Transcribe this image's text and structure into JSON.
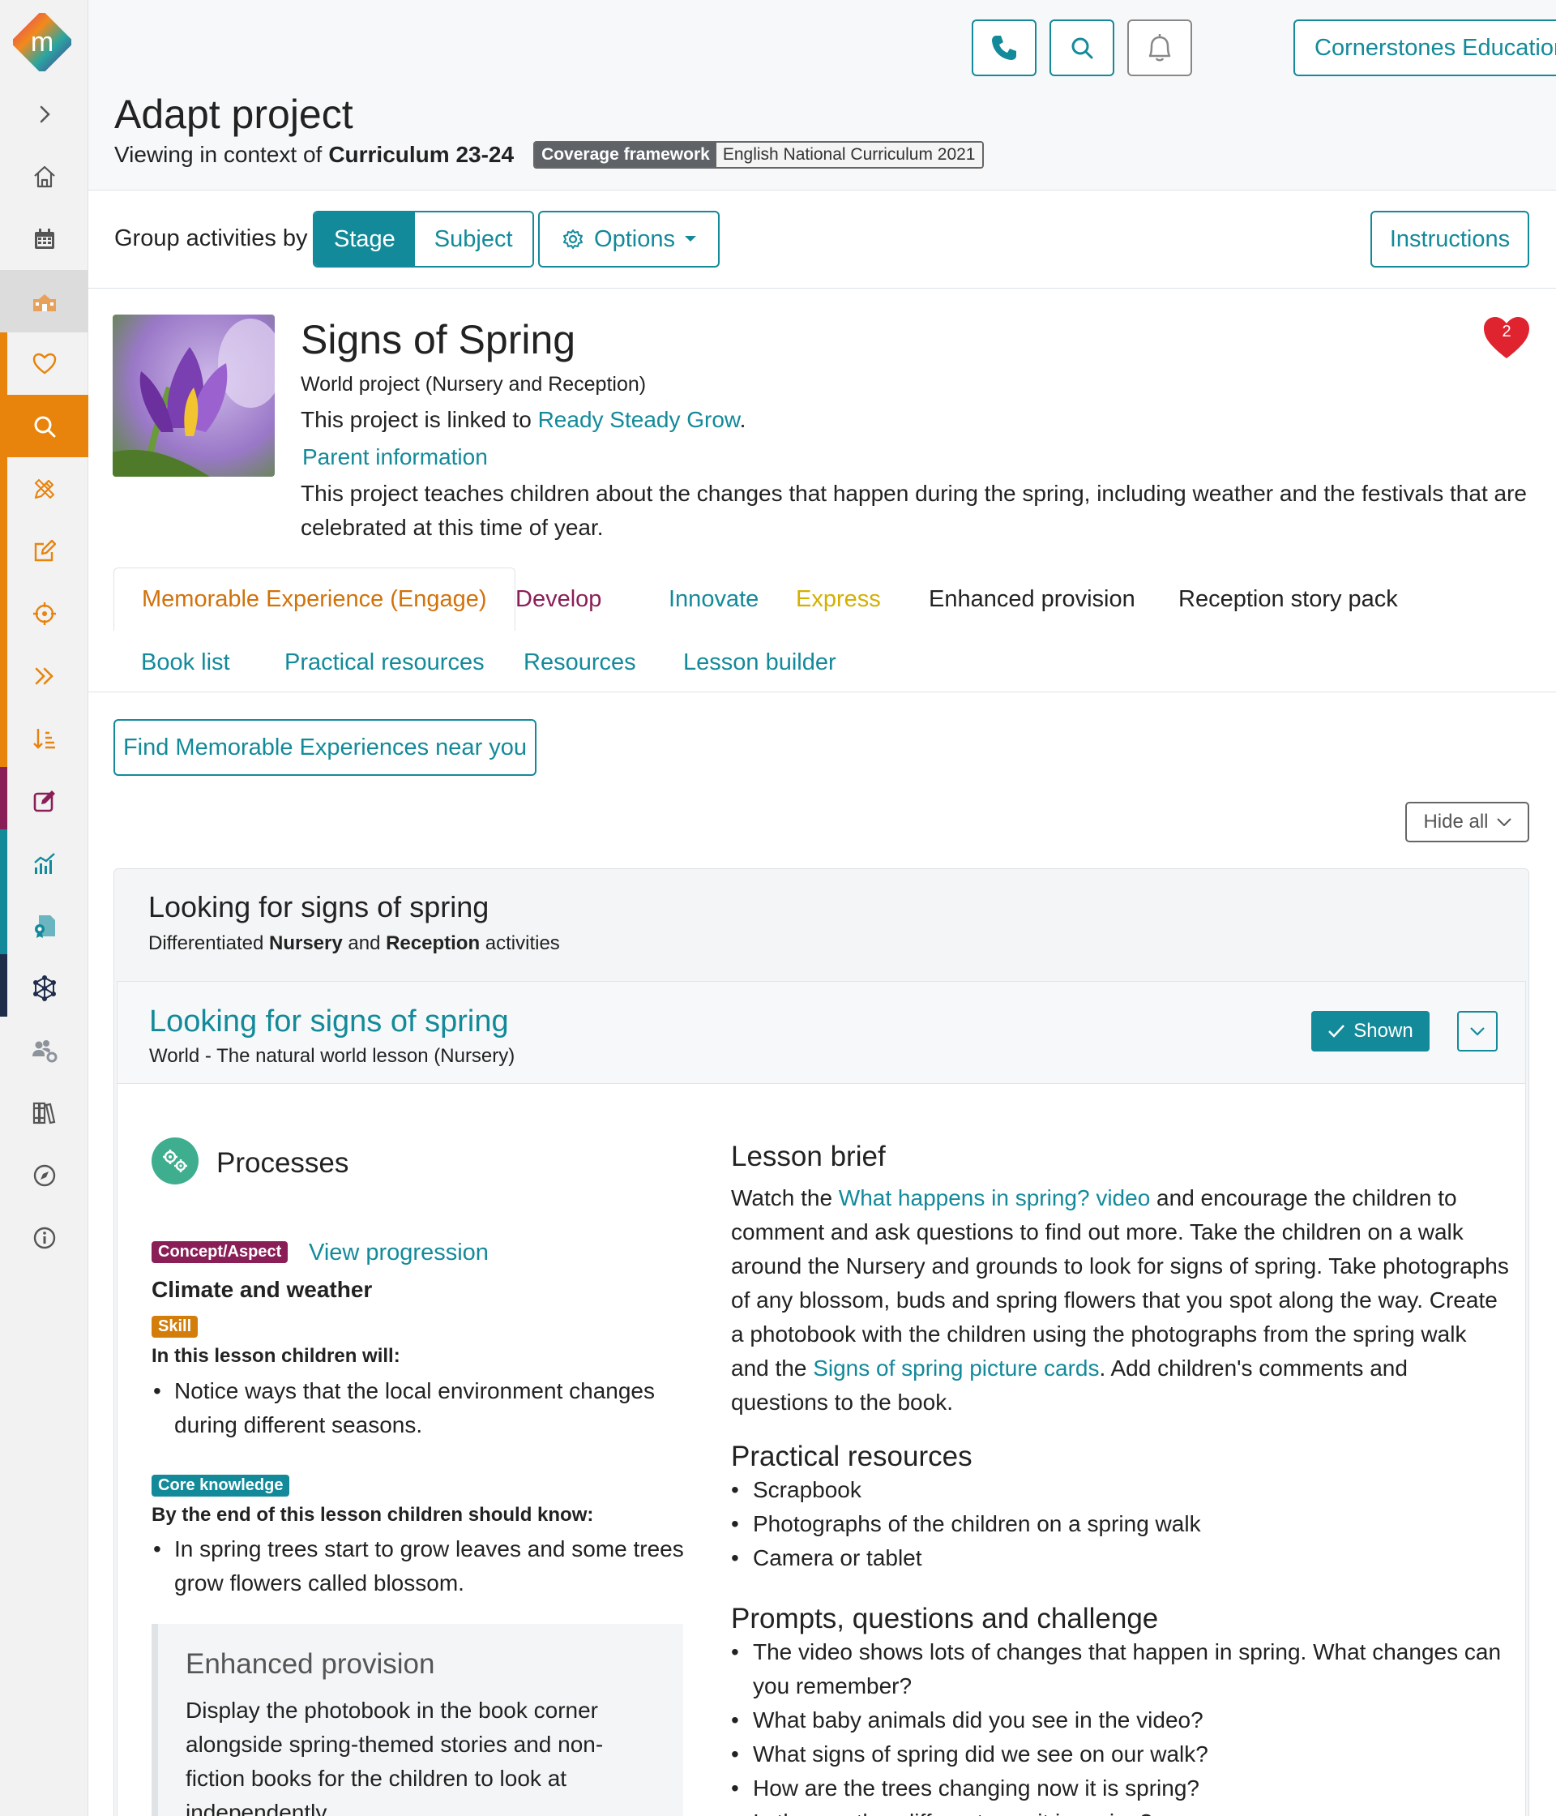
{
  "sidebar": {
    "logo_letter": "m",
    "items": [
      {
        "name": "expand",
        "icon": "chevron-right-icon"
      },
      {
        "name": "home",
        "icon": "home-icon"
      },
      {
        "name": "calendar",
        "icon": "calendar-icon"
      },
      {
        "name": "school",
        "icon": "school-icon"
      },
      {
        "name": "favourites",
        "icon": "heart-icon"
      },
      {
        "name": "search",
        "icon": "search-icon"
      },
      {
        "name": "adapt",
        "icon": "pencil-ruler-icon"
      },
      {
        "name": "edit",
        "icon": "edit-icon"
      },
      {
        "name": "target",
        "icon": "target-icon"
      },
      {
        "name": "fast-forward",
        "icon": "double-chevron-icon"
      },
      {
        "name": "sequence",
        "icon": "sort-list-icon"
      },
      {
        "name": "assess",
        "icon": "edit-square-icon"
      },
      {
        "name": "analytics",
        "icon": "chart-icon"
      },
      {
        "name": "certificate",
        "icon": "certificate-icon"
      },
      {
        "name": "network",
        "icon": "network-icon"
      },
      {
        "name": "users",
        "icon": "users-gear-icon"
      },
      {
        "name": "library",
        "icon": "library-icon"
      },
      {
        "name": "explore",
        "icon": "compass-icon"
      },
      {
        "name": "info",
        "icon": "info-icon"
      }
    ]
  },
  "header": {
    "org_name": "Cornerstones Education",
    "page_title": "Adapt project",
    "context_prefix": "Viewing in context of",
    "context_curriculum": "Curriculum 23-24",
    "coverage_key": "Coverage framework",
    "coverage_value": "English National Curriculum 2021"
  },
  "toolbar": {
    "group_label": "Group activities by",
    "group_options": [
      "Stage",
      "Subject"
    ],
    "group_selected": "Stage",
    "options_label": "Options",
    "instructions_label": "Instructions"
  },
  "project": {
    "title": "Signs of Spring",
    "subtitle": "World project (Nursery and Reception)",
    "linked_prefix": "This project is linked to",
    "linked_name": "Ready Steady Grow",
    "linked_suffix": ".",
    "parent_info": "Parent information",
    "description": "This project teaches children about the changes that happen during the spring, including weather and the festivals that are celebrated at this time of year.",
    "likes": "2"
  },
  "tabs": {
    "row1": [
      {
        "label": "Memorable Experience (Engage)",
        "color": "#d2720a",
        "active": true
      },
      {
        "label": "Develop",
        "color": "#8a1f57"
      },
      {
        "label": "Innovate",
        "color": "#138a9a"
      },
      {
        "label": "Express",
        "color": "#d4b000"
      },
      {
        "label": "Enhanced provision",
        "color": "#222222"
      },
      {
        "label": "Reception story pack",
        "color": "#222222"
      }
    ],
    "row2": [
      {
        "label": "Book list",
        "color": "#138a9a"
      },
      {
        "label": "Practical resources",
        "color": "#138a9a"
      },
      {
        "label": "Resources",
        "color": "#138a9a"
      },
      {
        "label": "Lesson builder",
        "color": "#138a9a"
      }
    ]
  },
  "find_button": "Find Memorable Experiences near you",
  "hide_all": "Hide all",
  "activity": {
    "title": "Looking for signs of spring",
    "sub_prefix": "Differentiated",
    "sub_nursery": "Nursery",
    "sub_and": "and",
    "sub_reception": "Reception",
    "sub_suffix": "activities",
    "lesson": {
      "title": "Looking for signs of spring",
      "subtitle": "World - The natural world lesson (Nursery)",
      "shown_label": "Shown",
      "processes_title": "Processes",
      "concept_badge": "Concept/Aspect",
      "view_progression": "View progression",
      "concept": "Climate and weather",
      "skill_badge": "Skill",
      "skill_intro": "In this lesson children will:",
      "skill_items": [
        "Notice ways that the local environment changes during different seasons."
      ],
      "core_badge": "Core knowledge",
      "core_intro": "By the end of this lesson children should know:",
      "core_items": [
        "In spring trees start to grow leaves and some trees grow flowers called blossom."
      ],
      "enhanced_title": "Enhanced provision",
      "enhanced_text": "Display the photobook in the book corner alongside spring-themed stories and non-fiction books for the children to look at independently.",
      "brief_title": "Lesson brief",
      "brief_p1": "Watch the",
      "brief_link1": "What happens in spring? video",
      "brief_p2": "and encourage the children to comment and ask questions to find out more. Take the children on a walk around the Nursery and grounds to look for signs of spring. Take photographs of any blossom, buds and spring flowers that you spot along the way. Create a photobook with the children using the photographs from the spring walk and the",
      "brief_link2": "Signs of spring picture cards",
      "brief_p3": ". Add children's comments and questions to the book.",
      "practical_title": "Practical resources",
      "practical_items": [
        "Scrapbook",
        "Photographs of the children on a spring walk",
        "Camera or tablet"
      ],
      "prompts_title": "Prompts, questions and challenge",
      "prompts_items": [
        "The video shows lots of changes that happen in spring. What changes can you remember?",
        "What baby animals did you see in the video?",
        "What signs of spring did we see on our walk?",
        "How are the trees changing now it is spring?",
        "Is the weather different now it is spring?"
      ]
    }
  },
  "colors": {
    "accent": "#138a9a",
    "orange": "#d2720a",
    "plum": "#8a1f57",
    "heart": "#e0242f"
  }
}
